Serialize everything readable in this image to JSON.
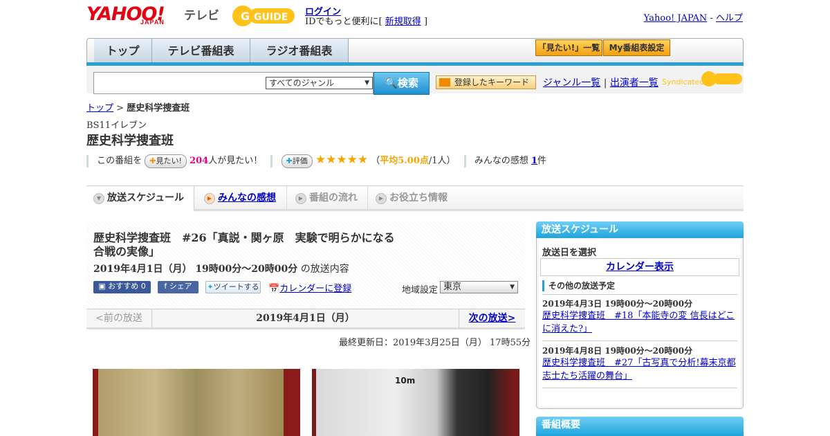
{
  "header": {
    "yahoo_logo": "YAHOO!",
    "yahoo_sub": "JAPAN",
    "tv_label": "テレビ",
    "gguide_logo": "GUIDE",
    "login": "ログイン",
    "id_prefix": "IDでもっと便利に[",
    "register": "新規取得",
    "id_suffix": "]",
    "yahoo_japan": "Yahoo! JAPAN",
    "dash": "-",
    "help": "ヘルプ"
  },
  "nav": {
    "tabs": [
      "トップ",
      "テレビ番組表",
      "ラジオ番組表"
    ],
    "want_list": "「見たい!」一覧",
    "my_schedule": "My番組表設定"
  },
  "search": {
    "genre": "すべてのジャンル",
    "button": "検索",
    "keyword_btn": "登録したキーワード",
    "genre_list": "ジャンル一覧",
    "bar": "|",
    "cast_list": "出演者一覧",
    "syndicated": "Syndicated"
  },
  "breadcrumb": {
    "home": "トップ",
    "sep": ">",
    "current": "歴史科学捜査班"
  },
  "program": {
    "station": "BS11イレブン",
    "title": "歴史科学捜査班",
    "want_prefix": "この番組を",
    "want_btn": "見たい!",
    "want_count": "204",
    "want_suffix": "人が見たい！",
    "rate_btn": "評価",
    "stars": "★★★★★",
    "avg_open": "（",
    "avg": "平均5.00点",
    "avg_close": "/1人）",
    "impressions_label": "みんなの感想",
    "impressions_count": "1",
    "impressions_unit": "件"
  },
  "subtabs": [
    "放送スケジュール",
    "みんなの感想",
    "番組の流れ",
    "お役立ち情報"
  ],
  "episode": {
    "title": "歴史科学捜査班　#26「真説・関ヶ原　実験で明らかになる合戦の実像」",
    "date": "2019年4月1日（月） 19時00分～20時00分",
    "date_suffix": "の放送内容",
    "fb_recommend": "おすすめ 0",
    "fb_share": "シェア",
    "tweet": "ツイートする",
    "calendar": "カレンダーに登録",
    "region_label": "地域設定",
    "region": "東京",
    "prev": "<前の放送",
    "current_date": "2019年4月1日（月）",
    "next": "次の放送>",
    "updated": "最終更新日：2019年3月25日（月）  17時55分"
  },
  "sidebar": {
    "schedule_title": "放送スケジュール",
    "select_date": "放送日を選択",
    "calendar_link": "カレンダー表示",
    "other_label": "その他の放送予定",
    "items": [
      {
        "date": "2019年4月3日  19時00分～20時00分",
        "link": "歴史科学捜査班　#18「本能寺の変 信長はどこに消えた?」"
      },
      {
        "date": "2019年4月8日  19時00分～20時00分",
        "link": "歴史科学捜査班　#27「古写真で分析!幕末京都志士たち活躍の舞台」"
      }
    ],
    "summary_title": "番組概要"
  },
  "photo_text": {
    "distance": "10m"
  },
  "colors": {
    "accent_blue": "#2a9fd6",
    "want_count": "#e4007f",
    "star": "#f5a500"
  }
}
